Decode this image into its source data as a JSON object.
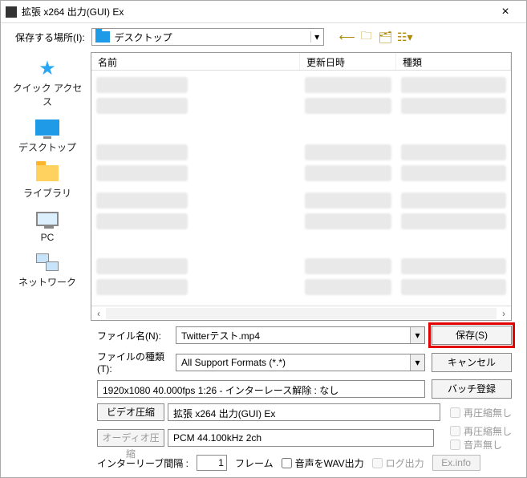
{
  "titlebar": {
    "title": "拡張 x264 出力(GUI) Ex"
  },
  "toolbar": {
    "save_in_label": "保存する場所(I):",
    "location": "デスクトップ"
  },
  "sidebar": {
    "items": [
      {
        "label": "クイック アクセス"
      },
      {
        "label": "デスクトップ"
      },
      {
        "label": "ライブラリ"
      },
      {
        "label": "PC"
      },
      {
        "label": "ネットワーク"
      }
    ]
  },
  "columns": {
    "name": "名前",
    "date": "更新日時",
    "type": "種類"
  },
  "form": {
    "filename_label": "ファイル名(N):",
    "filename_value": "Twitterテスト.mp4",
    "filetype_label": "ファイルの種類(T):",
    "filetype_value": "All Support Formats (*.*)",
    "save_btn": "保存(S)",
    "cancel_btn": "キャンセル"
  },
  "info": {
    "line": "1920x1080  40.000fps  1:26  -  インターレース解除 : なし",
    "batch_btn": "バッチ登録"
  },
  "video": {
    "btn": "ビデオ圧縮",
    "value": "拡張 x264 出力(GUI) Ex",
    "chk": "再圧縮無し"
  },
  "audio": {
    "btn": "オーディオ圧縮",
    "value": "PCM 44.100kHz 2ch",
    "chk1": "再圧縮無し",
    "chk2": "音声無し"
  },
  "interleave": {
    "label": "インターリーブ間隔 :",
    "value": "1",
    "unit": "フレーム",
    "wav_out": "音声をWAV出力",
    "log_out": "ログ出力",
    "exinfo": "Ex.info"
  }
}
